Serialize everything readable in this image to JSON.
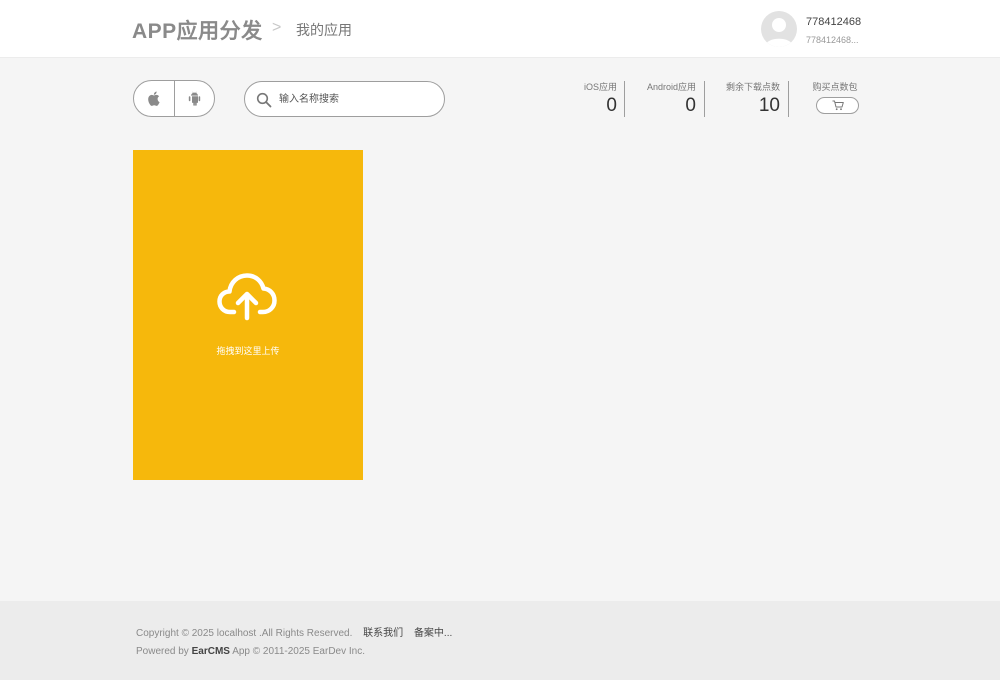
{
  "header": {
    "brand": "APP应用分发",
    "separator": ">",
    "current_page": "我的应用",
    "user": {
      "name": "778412468",
      "subtitle": "778412468..."
    }
  },
  "toolbar": {
    "platforms": [
      {
        "name": "apple-icon"
      },
      {
        "name": "android-icon"
      }
    ],
    "search": {
      "placeholder": "输入名称搜索",
      "value": "",
      "icon": "search-icon"
    }
  },
  "stats": [
    {
      "label": "iOS应用",
      "value": "0"
    },
    {
      "label": "Android应用",
      "value": "0"
    },
    {
      "label": "剩余下载点数",
      "value": "10"
    }
  ],
  "buy": {
    "label": "购买点数包",
    "icon": "cart-icon"
  },
  "upload": {
    "text": "拖拽到这里上传",
    "icon": "cloud-upload-icon",
    "color": "#f6b80c"
  },
  "footer": {
    "copyright": "Copyright © 2025 localhost .All Rights Reserved.",
    "contact_link": "联系我们",
    "icp_link": "备案中...",
    "powered_prefix": "Powered by",
    "powered_brand": "EarCMS",
    "powered_suffix": "App © 2011-2025 EarDev Inc."
  },
  "colors": {
    "accent": "#f6b80c",
    "background": "#f5f5f5",
    "header_bg": "#ffffff",
    "footer_bg": "#ececec"
  }
}
